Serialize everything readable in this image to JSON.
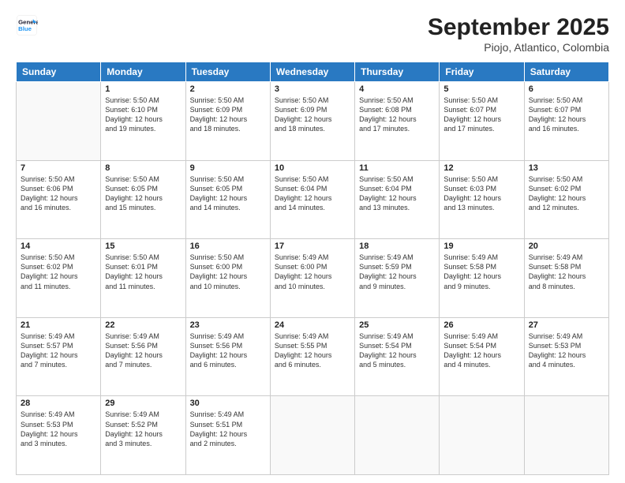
{
  "header": {
    "logo_line1": "General",
    "logo_line2": "Blue",
    "month": "September 2025",
    "location": "Piojo, Atlantico, Colombia"
  },
  "weekdays": [
    "Sunday",
    "Monday",
    "Tuesday",
    "Wednesday",
    "Thursday",
    "Friday",
    "Saturday"
  ],
  "weeks": [
    [
      {
        "day": "",
        "empty": true
      },
      {
        "day": "1",
        "sunrise": "5:50 AM",
        "sunset": "6:10 PM",
        "daylight": "12 hours and 19 minutes."
      },
      {
        "day": "2",
        "sunrise": "5:50 AM",
        "sunset": "6:09 PM",
        "daylight": "12 hours and 18 minutes."
      },
      {
        "day": "3",
        "sunrise": "5:50 AM",
        "sunset": "6:09 PM",
        "daylight": "12 hours and 18 minutes."
      },
      {
        "day": "4",
        "sunrise": "5:50 AM",
        "sunset": "6:08 PM",
        "daylight": "12 hours and 17 minutes."
      },
      {
        "day": "5",
        "sunrise": "5:50 AM",
        "sunset": "6:07 PM",
        "daylight": "12 hours and 17 minutes."
      },
      {
        "day": "6",
        "sunrise": "5:50 AM",
        "sunset": "6:07 PM",
        "daylight": "12 hours and 16 minutes."
      }
    ],
    [
      {
        "day": "7",
        "sunrise": "5:50 AM",
        "sunset": "6:06 PM",
        "daylight": "12 hours and 16 minutes."
      },
      {
        "day": "8",
        "sunrise": "5:50 AM",
        "sunset": "6:05 PM",
        "daylight": "12 hours and 15 minutes."
      },
      {
        "day": "9",
        "sunrise": "5:50 AM",
        "sunset": "6:05 PM",
        "daylight": "12 hours and 14 minutes."
      },
      {
        "day": "10",
        "sunrise": "5:50 AM",
        "sunset": "6:04 PM",
        "daylight": "12 hours and 14 minutes."
      },
      {
        "day": "11",
        "sunrise": "5:50 AM",
        "sunset": "6:04 PM",
        "daylight": "12 hours and 13 minutes."
      },
      {
        "day": "12",
        "sunrise": "5:50 AM",
        "sunset": "6:03 PM",
        "daylight": "12 hours and 13 minutes."
      },
      {
        "day": "13",
        "sunrise": "5:50 AM",
        "sunset": "6:02 PM",
        "daylight": "12 hours and 12 minutes."
      }
    ],
    [
      {
        "day": "14",
        "sunrise": "5:50 AM",
        "sunset": "6:02 PM",
        "daylight": "12 hours and 11 minutes."
      },
      {
        "day": "15",
        "sunrise": "5:50 AM",
        "sunset": "6:01 PM",
        "daylight": "12 hours and 11 minutes."
      },
      {
        "day": "16",
        "sunrise": "5:50 AM",
        "sunset": "6:00 PM",
        "daylight": "12 hours and 10 minutes."
      },
      {
        "day": "17",
        "sunrise": "5:49 AM",
        "sunset": "6:00 PM",
        "daylight": "12 hours and 10 minutes."
      },
      {
        "day": "18",
        "sunrise": "5:49 AM",
        "sunset": "5:59 PM",
        "daylight": "12 hours and 9 minutes."
      },
      {
        "day": "19",
        "sunrise": "5:49 AM",
        "sunset": "5:58 PM",
        "daylight": "12 hours and 9 minutes."
      },
      {
        "day": "20",
        "sunrise": "5:49 AM",
        "sunset": "5:58 PM",
        "daylight": "12 hours and 8 minutes."
      }
    ],
    [
      {
        "day": "21",
        "sunrise": "5:49 AM",
        "sunset": "5:57 PM",
        "daylight": "12 hours and 7 minutes."
      },
      {
        "day": "22",
        "sunrise": "5:49 AM",
        "sunset": "5:56 PM",
        "daylight": "12 hours and 7 minutes."
      },
      {
        "day": "23",
        "sunrise": "5:49 AM",
        "sunset": "5:56 PM",
        "daylight": "12 hours and 6 minutes."
      },
      {
        "day": "24",
        "sunrise": "5:49 AM",
        "sunset": "5:55 PM",
        "daylight": "12 hours and 6 minutes."
      },
      {
        "day": "25",
        "sunrise": "5:49 AM",
        "sunset": "5:54 PM",
        "daylight": "12 hours and 5 minutes."
      },
      {
        "day": "26",
        "sunrise": "5:49 AM",
        "sunset": "5:54 PM",
        "daylight": "12 hours and 4 minutes."
      },
      {
        "day": "27",
        "sunrise": "5:49 AM",
        "sunset": "5:53 PM",
        "daylight": "12 hours and 4 minutes."
      }
    ],
    [
      {
        "day": "28",
        "sunrise": "5:49 AM",
        "sunset": "5:53 PM",
        "daylight": "12 hours and 3 minutes."
      },
      {
        "day": "29",
        "sunrise": "5:49 AM",
        "sunset": "5:52 PM",
        "daylight": "12 hours and 3 minutes."
      },
      {
        "day": "30",
        "sunrise": "5:49 AM",
        "sunset": "5:51 PM",
        "daylight": "12 hours and 2 minutes."
      },
      {
        "day": "",
        "empty": true
      },
      {
        "day": "",
        "empty": true
      },
      {
        "day": "",
        "empty": true
      },
      {
        "day": "",
        "empty": true
      }
    ]
  ]
}
